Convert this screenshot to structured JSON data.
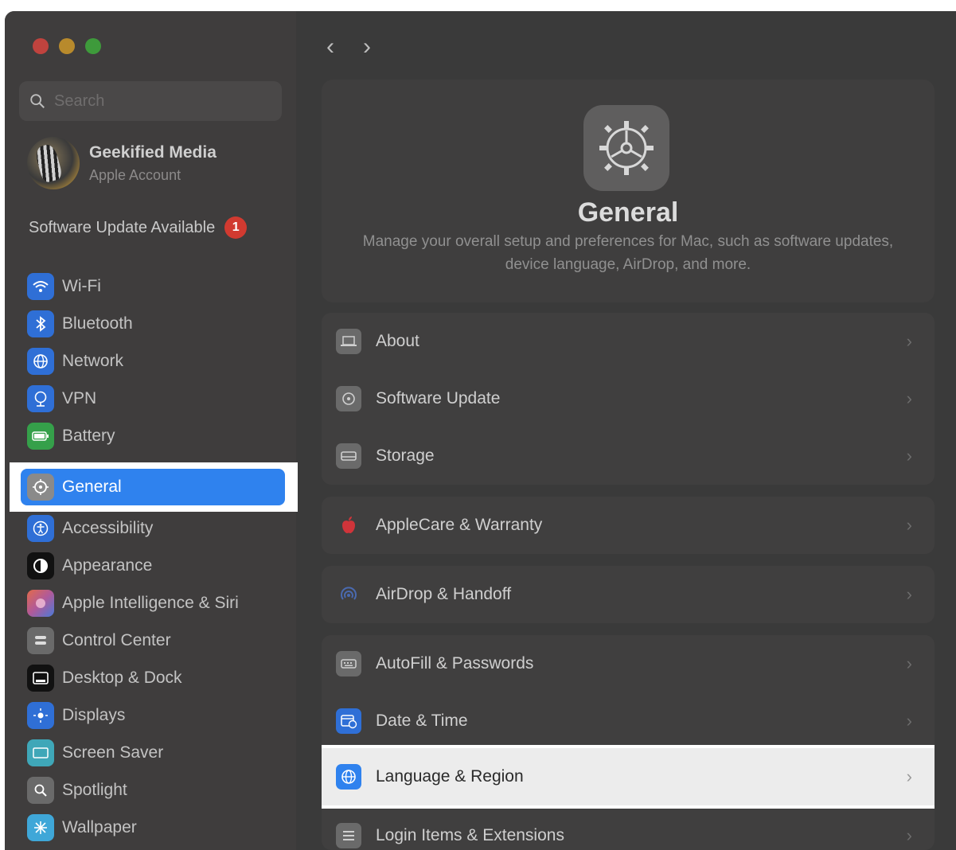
{
  "window": {
    "traffic_colors": [
      "#c0433e",
      "#b88a2c",
      "#3e9a3b"
    ]
  },
  "sidebar": {
    "search": {
      "placeholder": "Search",
      "icon": "search-icon"
    },
    "account": {
      "name": "Geekified Media",
      "subtitle": "Apple Account"
    },
    "update": {
      "label": "Software Update Available",
      "badge": "1"
    },
    "items": [
      {
        "label": "Wi-Fi",
        "icon": "wifi-icon",
        "color": "#2f6fd6"
      },
      {
        "label": "Bluetooth",
        "icon": "bluetooth-icon",
        "color": "#2f6fd6"
      },
      {
        "label": "Network",
        "icon": "globe-icon",
        "color": "#2f6fd6"
      },
      {
        "label": "VPN",
        "icon": "vpn-icon",
        "color": "#2f6fd6"
      },
      {
        "label": "Battery",
        "icon": "battery-icon",
        "color": "#35a04a"
      },
      {
        "label": "General",
        "icon": "gear-icon",
        "color": "#8a8a8a",
        "selected": true
      },
      {
        "label": "Accessibility",
        "icon": "accessibility-icon",
        "color": "#2f6fd6"
      },
      {
        "label": "Appearance",
        "icon": "appearance-icon",
        "color": "#111111"
      },
      {
        "label": "Apple Intelligence & Siri",
        "icon": "siri-icon",
        "color": "#b05a9a"
      },
      {
        "label": "Control Center",
        "icon": "control-center-icon",
        "color": "#6a6a6a"
      },
      {
        "label": "Desktop & Dock",
        "icon": "dock-icon",
        "color": "#111111"
      },
      {
        "label": "Displays",
        "icon": "displays-icon",
        "color": "#2f6fd6"
      },
      {
        "label": "Screen Saver",
        "icon": "screen-saver-icon",
        "color": "#3fa7b8"
      },
      {
        "label": "Spotlight",
        "icon": "spotlight-icon",
        "color": "#6a6a6a"
      },
      {
        "label": "Wallpaper",
        "icon": "wallpaper-icon",
        "color": "#3fa7d8"
      }
    ]
  },
  "main": {
    "nav": {
      "back": "‹",
      "forward": "›"
    },
    "header": {
      "title": "General",
      "description": "Manage your overall setup and preferences for Mac, such as software updates, device language, AirDrop, and more."
    },
    "groups": [
      {
        "rows": [
          {
            "label": "About",
            "icon": "laptop-icon",
            "color": "#6a6a6a"
          },
          {
            "label": "Software Update",
            "icon": "gear-icon",
            "color": "#6a6a6a"
          },
          {
            "label": "Storage",
            "icon": "storage-icon",
            "color": "#6a6a6a"
          }
        ]
      },
      {
        "rows": [
          {
            "label": "AppleCare & Warranty",
            "icon": "apple-icon",
            "color": "#d0343a"
          }
        ]
      },
      {
        "rows": [
          {
            "label": "AirDrop & Handoff",
            "icon": "airdrop-icon",
            "color": "#3a5aa0"
          }
        ]
      },
      {
        "rows": [
          {
            "label": "AutoFill & Passwords",
            "icon": "keyboard-icon",
            "color": "#6a6a6a"
          },
          {
            "label": "Date & Time",
            "icon": "calendar-clock-icon",
            "color": "#2f6fd6"
          },
          {
            "label": "Language & Region",
            "icon": "globe-icon",
            "color": "#2f82ee",
            "highlighted": true
          },
          {
            "label": "Login Items & Extensions",
            "icon": "list-icon",
            "color": "#6a6a6a"
          }
        ]
      }
    ]
  }
}
